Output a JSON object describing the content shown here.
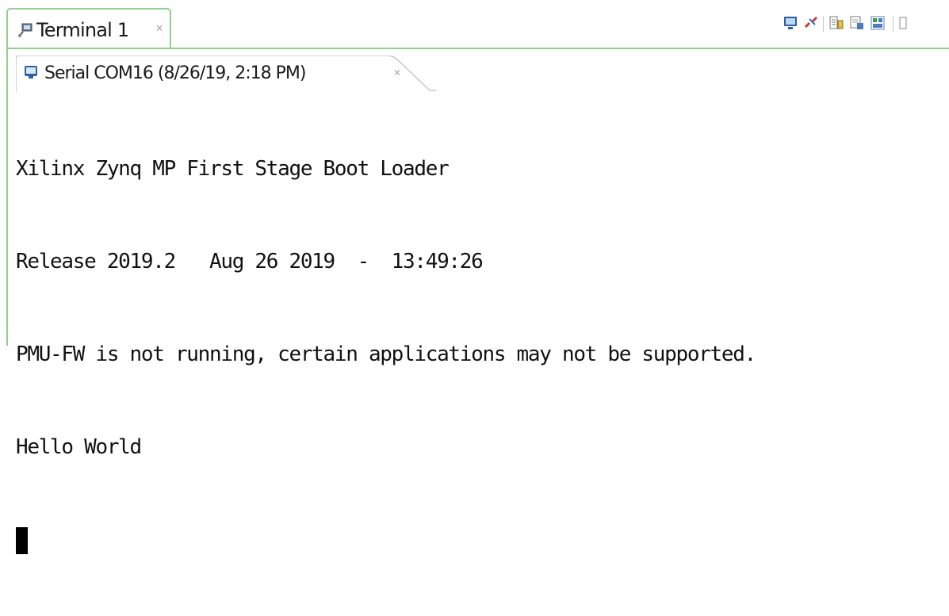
{
  "view": {
    "tab_label": "Terminal 1",
    "close_glyph": "⨯"
  },
  "toolbar": {
    "buttons": [
      "connect-icon",
      "disconnect-icon",
      "scroll-lock-icon",
      "clear-console-icon",
      "settings-icon"
    ]
  },
  "session": {
    "tab_label": "Serial COM16 (8/26/19, 2:18 PM)",
    "close_glyph": "⨯"
  },
  "console": {
    "lines": [
      "Xilinx Zynq MP First Stage Boot Loader",
      "Release 2019.2   Aug 26 2019  -  13:49:26",
      "PMU-FW is not running, certain applications may not be supported.",
      "Hello World"
    ]
  },
  "colors": {
    "active_border": "#8fd18f",
    "text": "#111111",
    "cursor": "#000000"
  }
}
